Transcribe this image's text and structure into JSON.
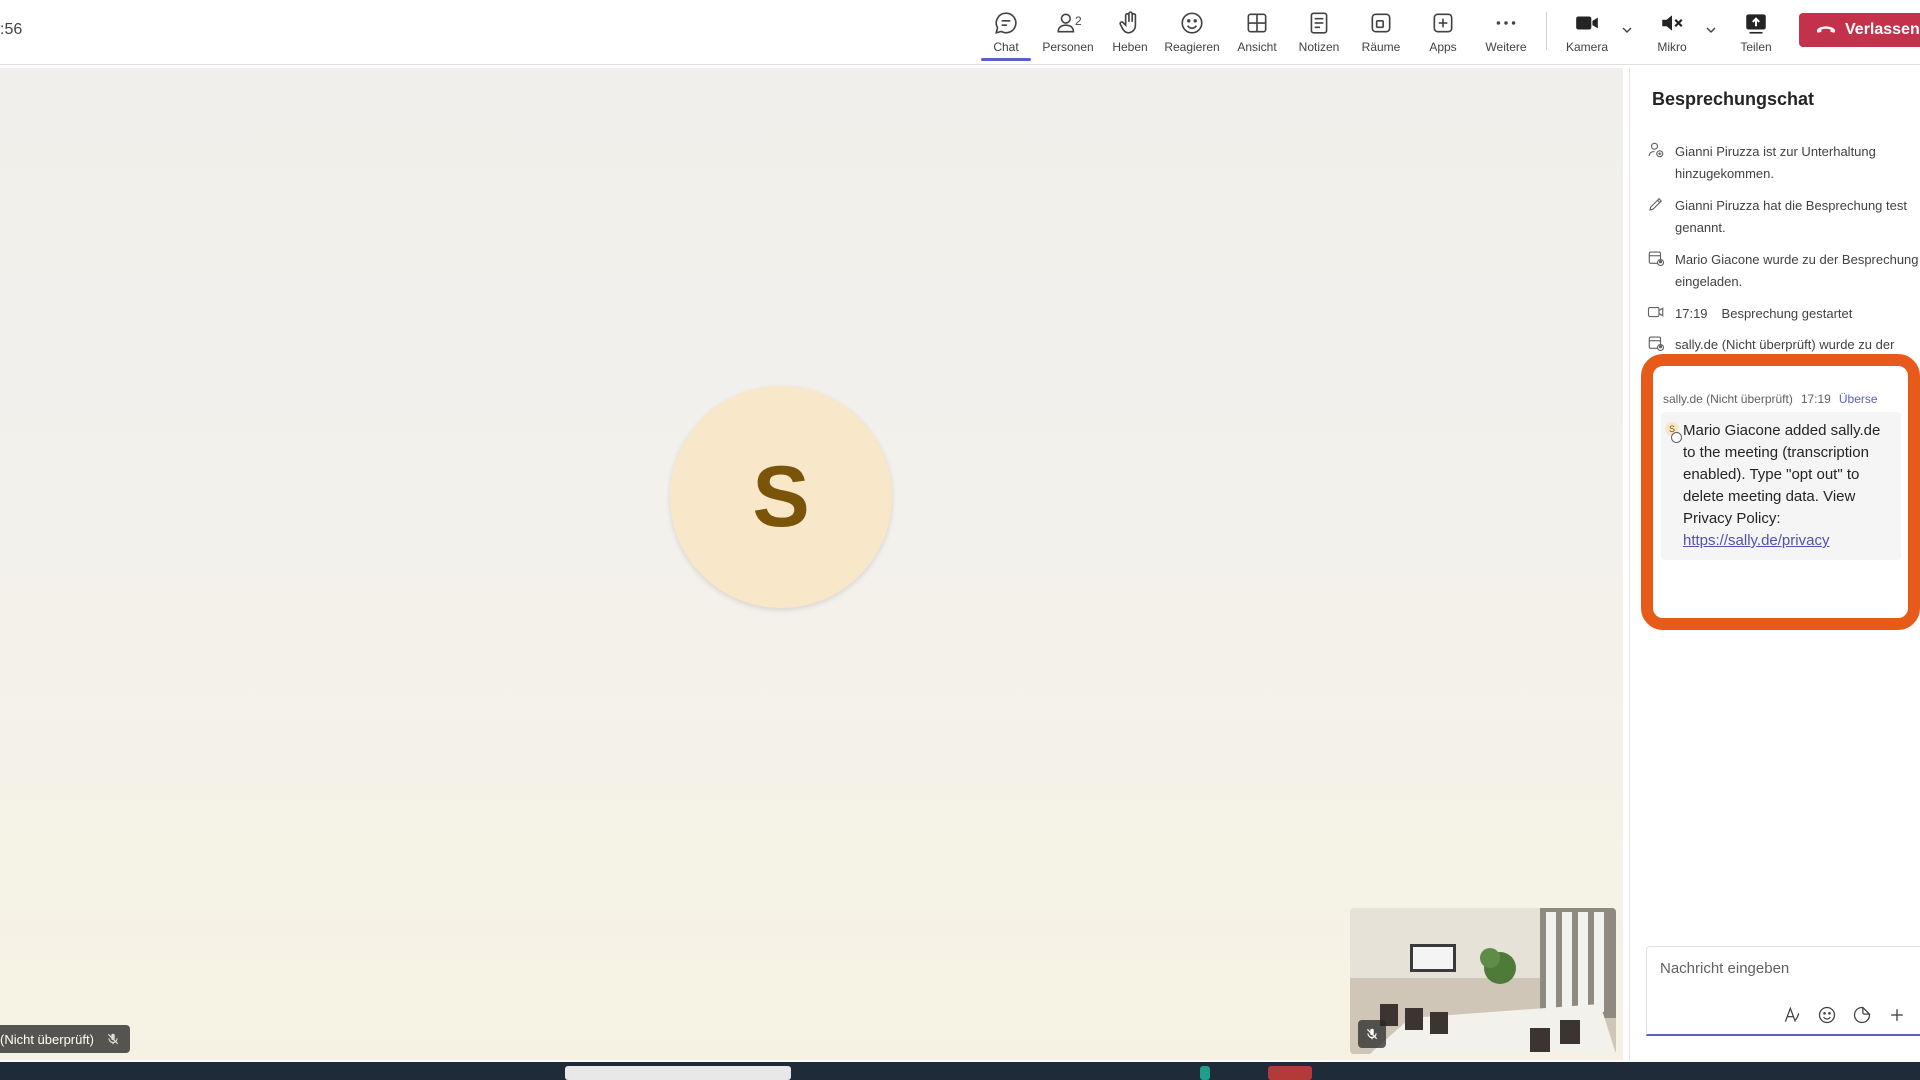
{
  "topbar": {
    "clock": ":56",
    "buttons": {
      "chat": "Chat",
      "people": "Personen",
      "people_count": "2",
      "raise": "Heben",
      "react": "Reagieren",
      "view": "Ansicht",
      "notes": "Notizen",
      "rooms": "Räume",
      "apps": "Apps",
      "more": "Weitere",
      "camera": "Kamera",
      "mic": "Mikro",
      "share": "Teilen"
    },
    "leave": "Verlassen"
  },
  "stage": {
    "avatar_initial": "S",
    "name_tag": "(Nicht überprüft)"
  },
  "chat": {
    "title": "Besprechungschat",
    "system_messages": [
      {
        "icon": "person-joined-icon",
        "text": "Gianni Piruzza ist zur Unterhaltung hinzugekommen."
      },
      {
        "icon": "pencil-icon",
        "text": "Gianni Piruzza hat die Besprechung test genannt."
      },
      {
        "icon": "calendar-person-icon",
        "text": "Mario Giacone wurde zu der Besprechung eingeladen."
      },
      {
        "icon": "video-icon",
        "time": "17:19",
        "text": "Besprechung gestartet"
      },
      {
        "icon": "calendar-person-icon",
        "text": "sally.de (Nicht überprüft) wurde zu der"
      }
    ],
    "message": {
      "sender": "sally.de (Nicht überprüft)",
      "time": "17:19",
      "translate": "Überse",
      "avatar_initial": "S",
      "body": "Mario Giacone added sally.de to the meeting (transcription enabled). Type \"opt out\" to delete meeting data. View Privacy Policy:",
      "link": "https://sally.de/privacy"
    },
    "compose_placeholder": "Nachricht eingeben"
  },
  "colors": {
    "accent": "#5b5fc7",
    "leave": "#c4314b",
    "highlight": "#e85a1a",
    "avatar_bg": "#f8e7c9",
    "avatar_fg": "#7a5408"
  }
}
